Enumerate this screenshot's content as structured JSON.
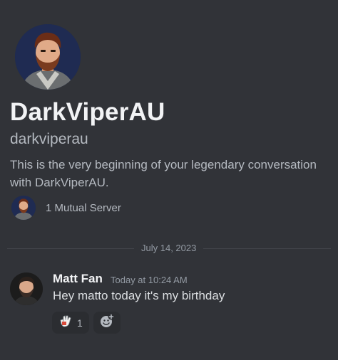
{
  "profile": {
    "display_name": "DarkViperAU",
    "username": "darkviperau",
    "intro": "This is the very beginning of your legendary conversation with DarkViperAU.",
    "mutual_servers": "1 Mutual Server"
  },
  "divider": {
    "date": "July 14, 2023"
  },
  "message": {
    "author": "Matt Fan",
    "timestamp": "Today at 10:24 AM",
    "text": "Hey matto today it's my birthday",
    "reactions": [
      {
        "emoji": "hand-emoji-icon",
        "count": "1"
      }
    ]
  },
  "colors": {
    "background": "#313338",
    "text_primary": "#f2f3f5",
    "text_muted": "#b5bac1",
    "reaction_bg": "#2b2d31"
  }
}
